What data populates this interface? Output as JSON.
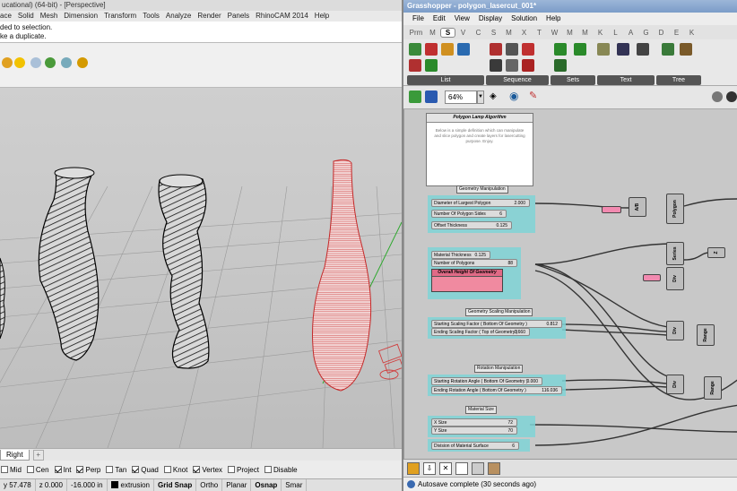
{
  "rhino": {
    "title": "ucational) (64-bit) - [Perspective]",
    "menu": [
      "ace",
      "Solid",
      "Mesh",
      "Dimension",
      "Transform",
      "Tools",
      "Analyze",
      "Render",
      "Panels",
      "RhinoCAM 2014",
      "Help"
    ],
    "cmd_lines": [
      "ded to selection.",
      "ke a duplicate."
    ],
    "viewport_tab": "Right",
    "osnaps": [
      {
        "label": "Mid",
        "on": false
      },
      {
        "label": "Cen",
        "on": false
      },
      {
        "label": "Int",
        "on": true
      },
      {
        "label": "Perp",
        "on": true
      },
      {
        "label": "Tan",
        "on": false
      },
      {
        "label": "Quad",
        "on": true
      },
      {
        "label": "Knot",
        "on": false
      },
      {
        "label": "Vertex",
        "on": true
      },
      {
        "label": "Project",
        "on": false
      },
      {
        "label": "Disable",
        "on": false
      }
    ],
    "status": {
      "y": "y 57.478",
      "z": "z 0.000",
      "dist": "-16.000 in",
      "layer": "extrusion",
      "grid_snap": "Grid Snap",
      "ortho": "Ortho",
      "planar": "Planar",
      "osnap": "Osnap",
      "smart": "Smar"
    }
  },
  "gh": {
    "title": "Grasshopper - polygon_lasercut_001*",
    "menu": [
      "File",
      "Edit",
      "View",
      "Display",
      "Solution",
      "Help"
    ],
    "tabs": [
      "Prm",
      "M",
      "S",
      "V",
      "C",
      "S",
      "M",
      "X",
      "T",
      "W",
      "M",
      "M",
      "K",
      "L",
      "A",
      "G",
      "D",
      "E",
      "K"
    ],
    "ribbon_groups": [
      "List",
      "Sequence",
      "Sets",
      "Text",
      "Tree"
    ],
    "zoom": "64%",
    "note_title": "Polygon Lamp Algorithm",
    "note_body": "Below is a simple definition which can manipulate and slice polygon and create layers for lasercutting purpose. Enjoy.",
    "group_labels": [
      "Geometry Manipulation",
      "Geometry Scaling Manipulation",
      "Rotation Manipulation",
      "Material Size"
    ],
    "sliders": [
      {
        "label": "Diameter of Largest Polygon",
        "value": "2.000"
      },
      {
        "label": "Number Of Polygon Sides",
        "value": "6"
      },
      {
        "label": "Offset Thickness",
        "value": "0.125"
      },
      {
        "label": "Material Thickness",
        "value": "0.125"
      },
      {
        "label": "Number of Polygons",
        "value": "88"
      },
      {
        "label": "Starting Scaling Factor ( Bottom Of Geometry )",
        "value": "0.812"
      },
      {
        "label": "Ending Scaling Factor ( Top of Geometry )",
        "value": "0.660"
      },
      {
        "label": "Starting Rotation Angle ( Bottom Of Geometry )",
        "value": "0.000"
      },
      {
        "label": "Ending Rotation Angle ( Bottom Of Geometry )",
        "value": "116.036"
      },
      {
        "label": "X Size",
        "value": "72"
      },
      {
        "label": "Y Size",
        "value": "70"
      },
      {
        "label": "Division of Material Surface",
        "value": "6"
      }
    ],
    "overall_panel": "Overall Height Of Geometry",
    "components": [
      "A/B",
      "Polygon",
      "Series",
      "Z",
      "Div",
      "Range",
      "Div",
      "Range",
      "Div",
      "Range"
    ],
    "status": "Autosave complete (30 seconds ago)"
  }
}
